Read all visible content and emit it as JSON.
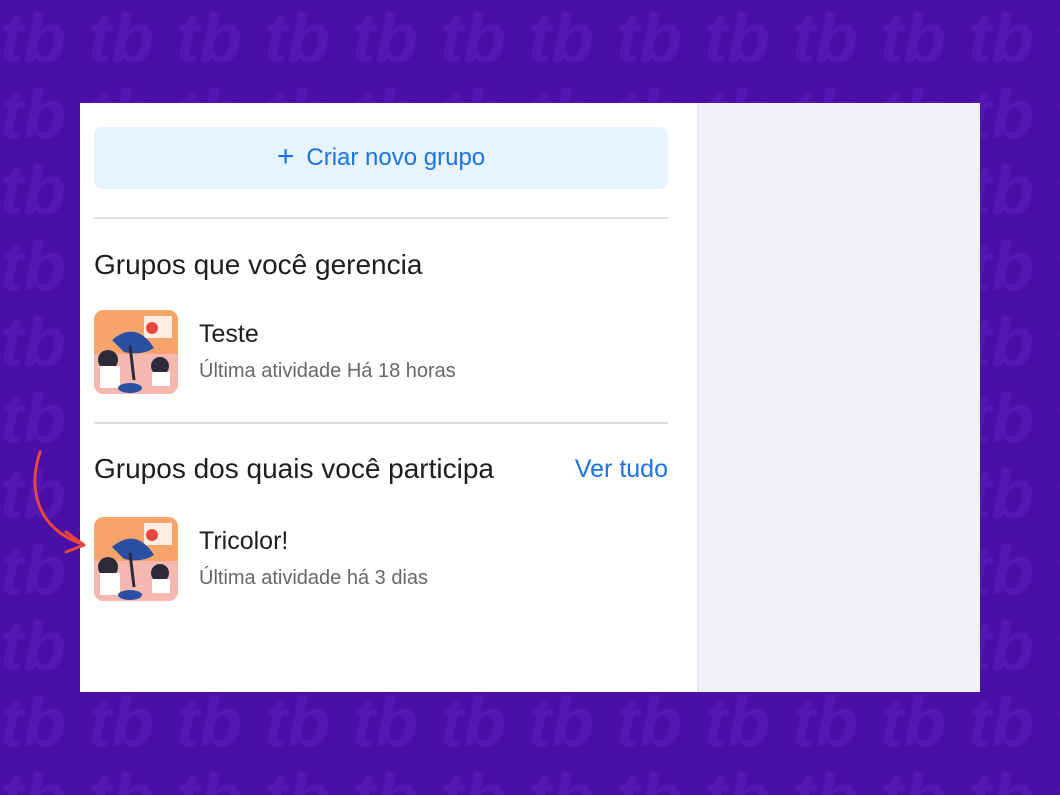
{
  "create_button": {
    "icon": "plus-icon",
    "label": "Criar novo grupo"
  },
  "managed": {
    "title": "Grupos que você gerencia",
    "groups": [
      {
        "name": "Teste",
        "activity": "Última atividade Há 18 horas"
      }
    ]
  },
  "member": {
    "title": "Grupos dos quais você participa",
    "see_all": "Ver tudo",
    "groups": [
      {
        "name": "Tricolor!",
        "activity": "Última atividade há 3 dias"
      }
    ]
  },
  "colors": {
    "background": "#4a0fa6",
    "accent": "#1b74e4",
    "annotation_arrow": "#e8453c"
  }
}
